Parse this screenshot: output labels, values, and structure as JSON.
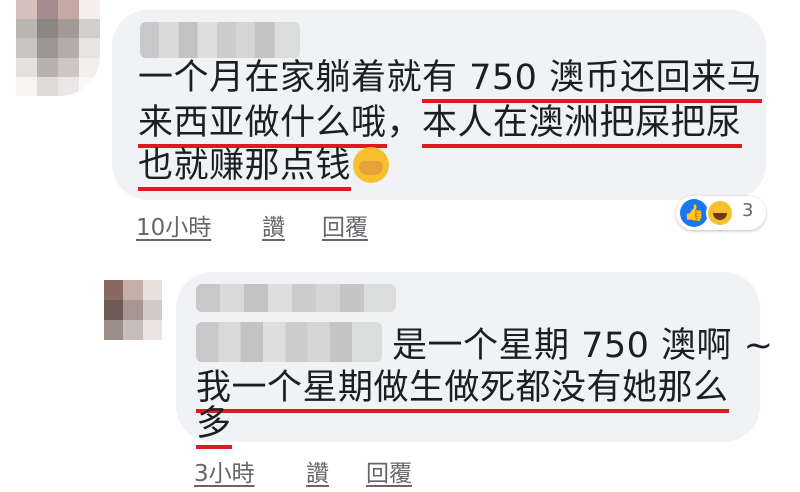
{
  "avatar1_colors": [
    "#d8bfbc",
    "#a58c8e",
    "#c4a9a5",
    "#f5eeee",
    "#b9b5b0",
    "#8a8684",
    "#a39995",
    "#d2cfcc",
    "#c9c5c2",
    "#9a9795",
    "#b3aca8",
    "#e8e4e2",
    "#e4e0de",
    "#b8b2ae",
    "#ccc7c4",
    "#f2efee",
    "#f7f5f4",
    "#dedad8",
    "#ebe7e6",
    "#faf9f8"
  ],
  "avatar2_colors": [
    "#8a6a60",
    "#c4b0a8",
    "#e8e0dc",
    "#6d5a55",
    "#a79790",
    "#d4cac6",
    "#9c8f8a",
    "#c8bdb8",
    "#ebe6e3"
  ],
  "comment1": {
    "lines": [
      {
        "plain": "一个月在家躺着就",
        "underlined": "有 750 澳币还回来马"
      },
      {
        "plain": "",
        "underlined": "来西亚做什么哦",
        "plain2": "，",
        "underlined2": "本人在澳洲把屎把尿"
      },
      {
        "plain": "",
        "underlined": "也就赚那点钱"
      }
    ],
    "emoji": "face-palm-emoji",
    "time": "10小時",
    "like": "讚",
    "reply": "回覆",
    "reaction_count": "3"
  },
  "comment2": {
    "line1": "是一个星期 750 澳啊 ~",
    "line2": "我一个星期做生做死都没有她那么",
    "line3": "多",
    "time": "3小時",
    "like": "讚",
    "reply": "回覆"
  }
}
